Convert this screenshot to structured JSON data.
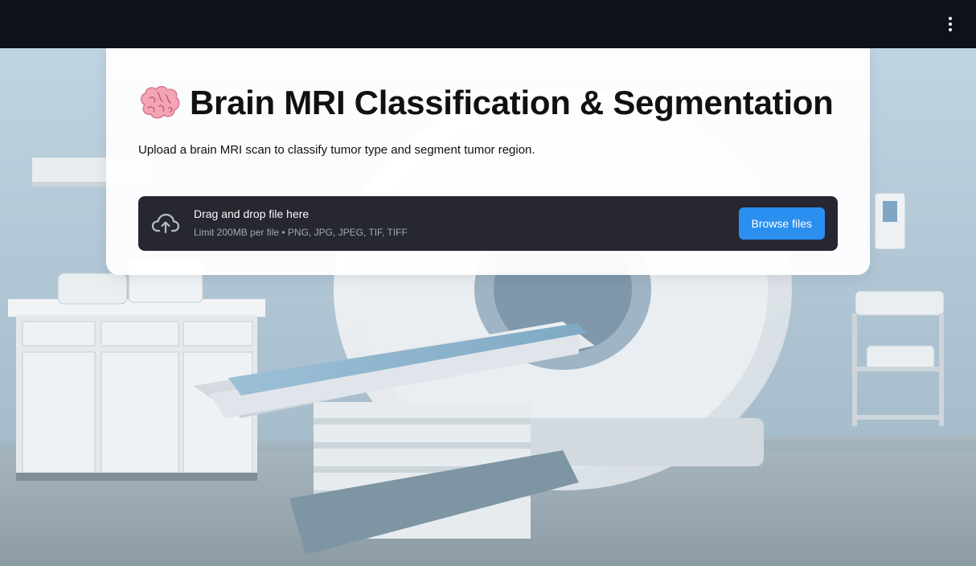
{
  "app_bar": {
    "menu_icon": "more-vertical-icon"
  },
  "header": {
    "icon": "brain-emoji-icon",
    "title": "Brain MRI Classification & Segmentation",
    "subtitle": "Upload a brain MRI scan to classify tumor type and segment tumor region."
  },
  "uploader": {
    "icon": "cloud-upload-icon",
    "drop_label": "Drag and drop file here",
    "limit_text": "Limit 200MB per file • PNG, JPG, JPEG, TIF, TIFF",
    "browse_label": "Browse files"
  },
  "colors": {
    "app_bar": "#0e1117",
    "uploader_bg": "#262730",
    "primary_button": "#2b8ff0",
    "card_bg": "#ffffff"
  }
}
